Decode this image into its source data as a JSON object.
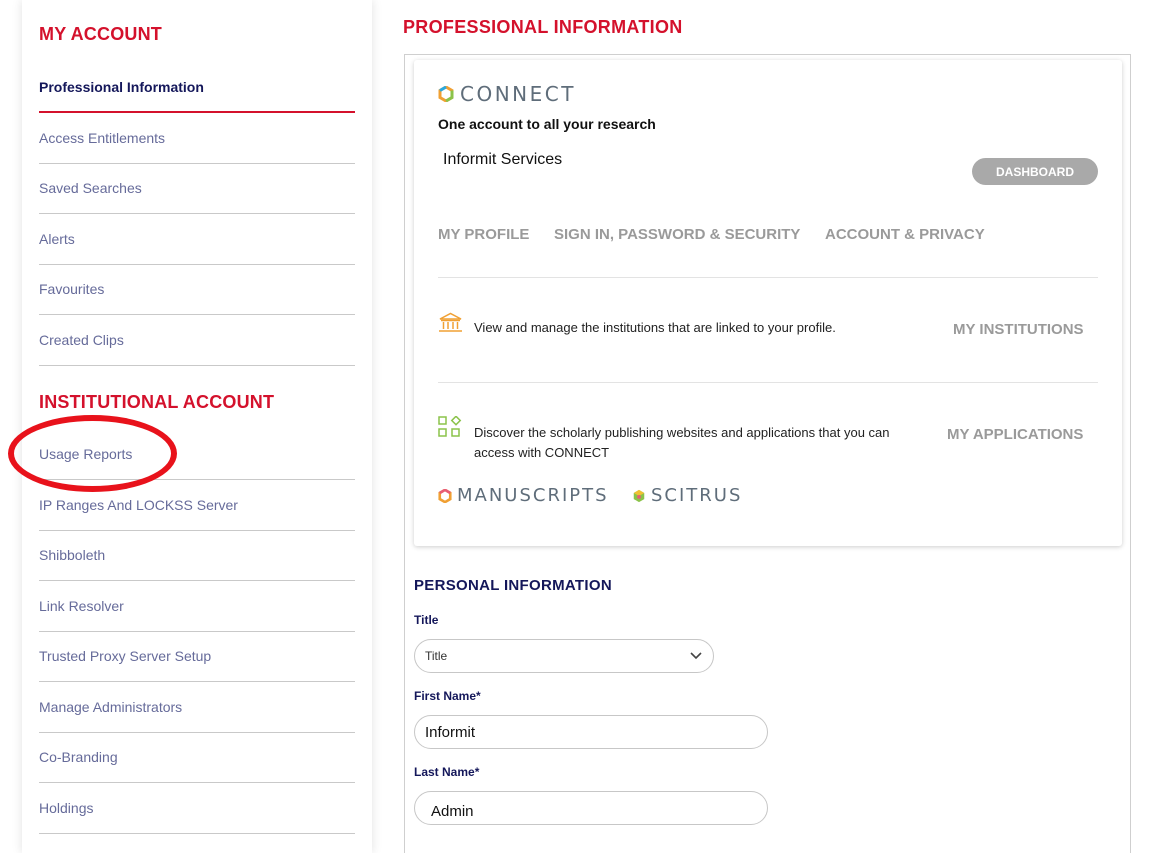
{
  "sidebar": {
    "my_account_heading": "MY ACCOUNT",
    "my_account_items": [
      {
        "label": "Professional Information"
      },
      {
        "label": "Access Entitlements"
      },
      {
        "label": "Saved Searches"
      },
      {
        "label": "Alerts"
      },
      {
        "label": "Favourites"
      },
      {
        "label": "Created Clips"
      }
    ],
    "institutional_heading": "INSTITUTIONAL ACCOUNT",
    "institutional_items": [
      {
        "label": "Usage Reports"
      },
      {
        "label": "IP Ranges And LOCKSS Server"
      },
      {
        "label": "Shibboleth"
      },
      {
        "label": "Link Resolver"
      },
      {
        "label": "Trusted Proxy Server Setup"
      },
      {
        "label": "Manage Administrators"
      },
      {
        "label": "Co-Branding"
      },
      {
        "label": "Holdings"
      }
    ]
  },
  "main": {
    "title": "PROFESSIONAL INFORMATION",
    "connect": {
      "logo_text": "CONNECT",
      "tagline": "One account to all your research",
      "org_name": "Informit Services",
      "dashboard_label": "DASHBOARD",
      "tabs": [
        "MY PROFILE",
        "SIGN IN, PASSWORD & SECURITY",
        "ACCOUNT & PRIVACY"
      ],
      "institutions_text": "View and manage the institutions that are linked to your profile.",
      "institutions_link": "MY INSTITUTIONS",
      "applications_text": "Discover the scholarly publishing websites and applications that you can access with CONNECT",
      "applications_link": "MY APPLICATIONS",
      "apps": [
        "MANUSCRIPTS",
        "SCITRUS"
      ]
    },
    "personal": {
      "title": "PERSONAL INFORMATION",
      "title_label": "Title",
      "title_value": "Title",
      "first_name_label": "First Name*",
      "first_name_value": "Informit",
      "last_name_label": "Last Name*",
      "last_name_value": "Admin"
    }
  },
  "colors": {
    "brand_red": "#d4112c",
    "nav_text": "#666b9a",
    "dark_navy": "#14175a",
    "annotation_red": "#e8121b",
    "connect_orange": "#f0a033",
    "connect_green": "#8bc34a"
  }
}
